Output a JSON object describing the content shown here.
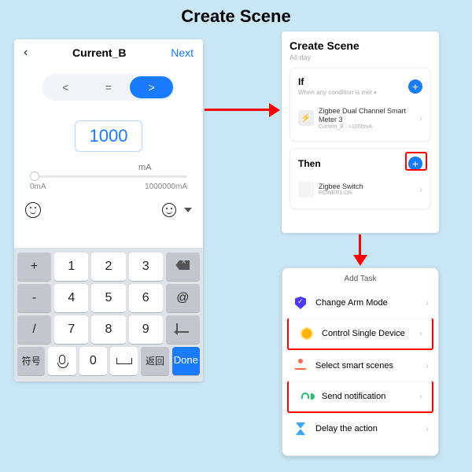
{
  "main_title": "Create Scene",
  "left": {
    "title": "Current_B",
    "next": "Next",
    "comparators": {
      "lt": "<",
      "eq": "=",
      "gt": ">"
    },
    "value": "1000",
    "unit": "mA",
    "range_min": "0mA",
    "range_max": "1000000mA",
    "keys": {
      "plus": "+",
      "k1": "1",
      "k2": "2",
      "k3": "3",
      "minus": "-",
      "k4": "4",
      "k5": "5",
      "k6": "6",
      "slash": "/",
      "k7": "7",
      "k8": "8",
      "k9": "9",
      "sym": "符号",
      "dot": ".",
      "k0": "0",
      "back": "返回",
      "done": "Done"
    }
  },
  "rt": {
    "title": "Create Scene",
    "subtitle": "All day",
    "if": {
      "title": "If",
      "subtitle": "When any condition is met",
      "device_name": "Zigbee Dual Channel Smart Meter 3",
      "device_sub": "Current_B : >1000mA"
    },
    "then": {
      "title": "Then",
      "device_name": "Zigbee Switch",
      "device_sub": "POWER1:ON"
    }
  },
  "rb": {
    "title": "Add Task",
    "tasks": {
      "arm": "Change Arm Mode",
      "control": "Control Single Device",
      "scenes": "Select smart scenes",
      "notify": "Send notification",
      "delay": "Delay the action"
    }
  }
}
